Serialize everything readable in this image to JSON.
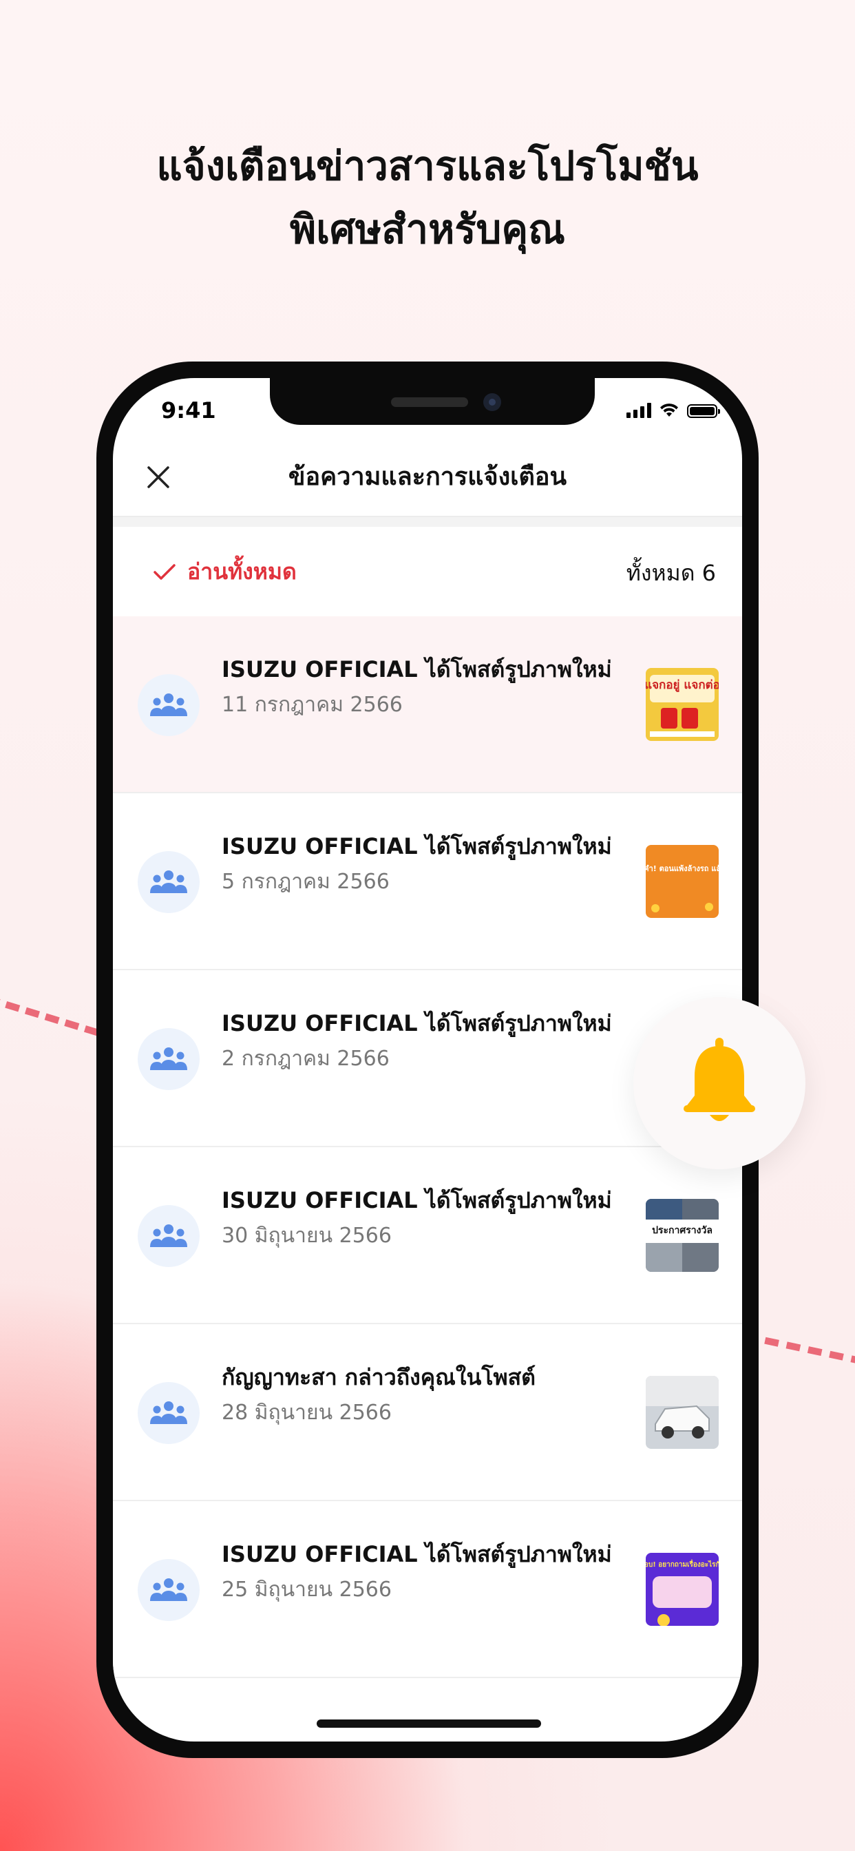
{
  "headline": {
    "line1": "แจ้งเตือนข่าวสารและโปรโมชัน",
    "line2": "พิเศษสำหรับคุณ"
  },
  "status_bar": {
    "time": "9:41"
  },
  "nav": {
    "title": "ข้อความและการแจ้งเตือน",
    "close_icon": "close-icon"
  },
  "actions": {
    "read_all_label": "อ่านทั้งหมด",
    "total_label": "ทั้งหมด 6"
  },
  "notifications": [
    {
      "title": "ISUZU OFFICIAL ได้โพสต์รูปภาพใหม่",
      "date": "11 กรกฎาคม 2566",
      "unread": true,
      "thumb_text": "แจกอยู่ แจกต่อ"
    },
    {
      "title": "ISUZU OFFICIAL ได้โพสต์รูปภาพใหม่",
      "date": "5 กรกฎาคม 2566",
      "unread": false,
      "thumb_text": "ขอสามคำ! ตอนแพ้งล้างรถ แล้วฝนตก"
    },
    {
      "title": "ISUZU OFFICIAL ได้โพสต์รูปภาพใหม่",
      "date": "2 กรกฎาคม 2566",
      "unread": false,
      "thumb_text": ""
    },
    {
      "title": "ISUZU OFFICIAL ได้โพสต์รูปภาพใหม่",
      "date": "30 มิถุนายน 2566",
      "unread": false,
      "thumb_text": "ประกาศรางวัล"
    },
    {
      "title": "กัญญาทะสา กล่าวถึงคุณในโพสต์",
      "date": "28 มิถุนายน 2566",
      "unread": false,
      "thumb_text": ""
    },
    {
      "title": "ISUZU OFFICIAL ได้โพสต์รูปภาพใหม่",
      "date": "25 มิถุนายน 2566",
      "unread": false,
      "thumb_text": "ถาม-ตอบ! อยากถามเรื่องอะไรกันบ้าง?"
    }
  ],
  "colors": {
    "accent_red": "#e0323c",
    "bell_yellow": "#ffb800",
    "group_icon_blue": "#5a8de6",
    "unread_bg": "#fdf3f4"
  }
}
